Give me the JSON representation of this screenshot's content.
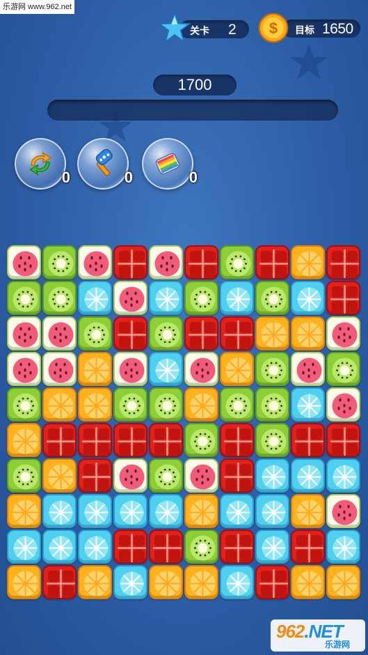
{
  "watermark": {
    "text": "乐游网 www.962.net"
  },
  "hud": {
    "level": {
      "label": "关卡",
      "value": "2",
      "icon": "star-icon"
    },
    "target": {
      "label": "目标",
      "value": "1650",
      "icon": "dollar-coin-icon"
    },
    "score": "1700",
    "progress": 0
  },
  "boosters": [
    {
      "name": "shuffle-booster",
      "icon": "shuffle-arrows-icon",
      "count": "0"
    },
    {
      "name": "hammer-booster",
      "icon": "hammer-icon",
      "count": "0"
    },
    {
      "name": "rainbow-booster",
      "icon": "rainbow-block-icon",
      "count": "0"
    }
  ],
  "board": {
    "cols": 10,
    "rows": 10,
    "legend": {
      "W": "watermelon",
      "K": "kiwi",
      "T": "tomato",
      "O": "orange",
      "I": "ice"
    },
    "grid": [
      "WKWTWTKTOT",
      "KKIWIKIKIT",
      "WWKTKTTOOW",
      "WWOWIWOKWK",
      "KOOKKOKKIW",
      "OTTTTKTKTT",
      "KOTWKWTIII",
      "OIIIIOIIOW",
      "IIITTKTITI",
      "OTOIOOITOO"
    ]
  },
  "colors": {
    "accent": "#ffb21c",
    "background": "#2d5ea6"
  },
  "logo": {
    "main": "962",
    "main_suffix": ".NET",
    "sub": "乐游网"
  }
}
